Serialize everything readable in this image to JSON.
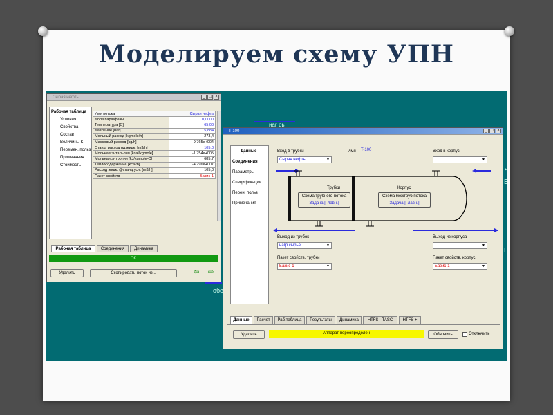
{
  "slide": {
    "title": "Моделируем схему УПН"
  },
  "background": {
    "overlays": [
      "наг ры",
      "Е",
      "ч",
      "Е",
      "обе"
    ]
  },
  "stream_window": {
    "title": "Сырая нефть",
    "nav": {
      "header": "Рабочая таблица",
      "items": [
        "Условия",
        "Свойства",
        "Состав",
        "Величины К",
        "Перемен. польз",
        "Примечания",
        "Стоимость"
      ]
    },
    "table": {
      "col_name": "Имя потока",
      "col_value": "Сырая нефть",
      "rows": [
        {
          "name": "Доля пара/фазы",
          "value": "0,0000",
          "style": "blue"
        },
        {
          "name": "Температура [C]",
          "value": "65,00",
          "style": "blue"
        },
        {
          "name": "Давление [bar]",
          "value": "5,884",
          "style": "blue"
        },
        {
          "name": "Мольный расход [kgmole/h]",
          "value": "273,4",
          "style": "black"
        },
        {
          "name": "Массовый расход [kg/h]",
          "value": "9,765e+004",
          "style": "black"
        },
        {
          "name": "Станд. расход нд.жидк. [m3/h]",
          "value": "105,0",
          "style": "blue"
        },
        {
          "name": "Мольная энтальпия [kcal/kgmole]",
          "value": "-1,754e+005",
          "style": "black"
        },
        {
          "name": "Мольная энтропия [kJ/kgmole-C]",
          "value": "685,7",
          "style": "black"
        },
        {
          "name": "Теплосодержание [kcal/h]",
          "value": "-4,796e+007",
          "style": "black"
        },
        {
          "name": "Расход жидк. @станд.усл. [m3/h]",
          "value": "105,0",
          "style": "black"
        },
        {
          "name": "Пакет свойств",
          "value": "Базис-1",
          "style": "red"
        }
      ]
    },
    "tabs": [
      "Рабочая таблица",
      "Соединения",
      "Динамика"
    ],
    "status": "ОК",
    "delete_btn": "Удалить",
    "copy_btn": "Скопировать поток из...",
    "arrow_left": "⇦",
    "arrow_right": "⇨"
  },
  "exchanger_window": {
    "title": "T-100",
    "nav": {
      "header": "Данные",
      "items": [
        "Соединения",
        "Параметры",
        "Спецификации",
        "Перен. польз",
        "Примечания"
      ]
    },
    "tube_inlet": {
      "label": "Вход в трубки",
      "value": "Сырая нефть"
    },
    "name": {
      "label": "Имя",
      "value": "T-100"
    },
    "shell_inlet": {
      "label": "Вход в корпус",
      "value": ""
    },
    "tube_side_label": "Трубки",
    "shell_side_label": "Корпус",
    "tube_scheme_btn": "Схема трубного потока",
    "tube_scheme_sub": "Задача [Главн.]",
    "shell_scheme_btn": "Схема межтруб.потока",
    "shell_scheme_sub": "Задача [Главн.]",
    "tube_outlet": {
      "label": "Выход из трубок",
      "value": "нагр.сырье"
    },
    "shell_outlet": {
      "label": "Выход из корпуса",
      "value": ""
    },
    "tube_pkg": {
      "label": "Пакет свойств, трубки",
      "value": "Базис-1"
    },
    "shell_pkg": {
      "label": "Пакет свойств, корпус",
      "value": "Базис-1"
    },
    "tabs": [
      "Данные",
      "Расчет",
      "Раб.таблица",
      "Результаты",
      "Динамика",
      "HTFS - TASC",
      "HTFS +"
    ],
    "delete_btn": "Удалить",
    "status": "Аппарат переопределен",
    "update_btn": "Обновить",
    "disable_label": "Отключить",
    "colors": {
      "active_title": "#1e5fbf",
      "status_yellow": "#f7f700",
      "status_green": "#119911",
      "workspace": "#026b72"
    }
  }
}
